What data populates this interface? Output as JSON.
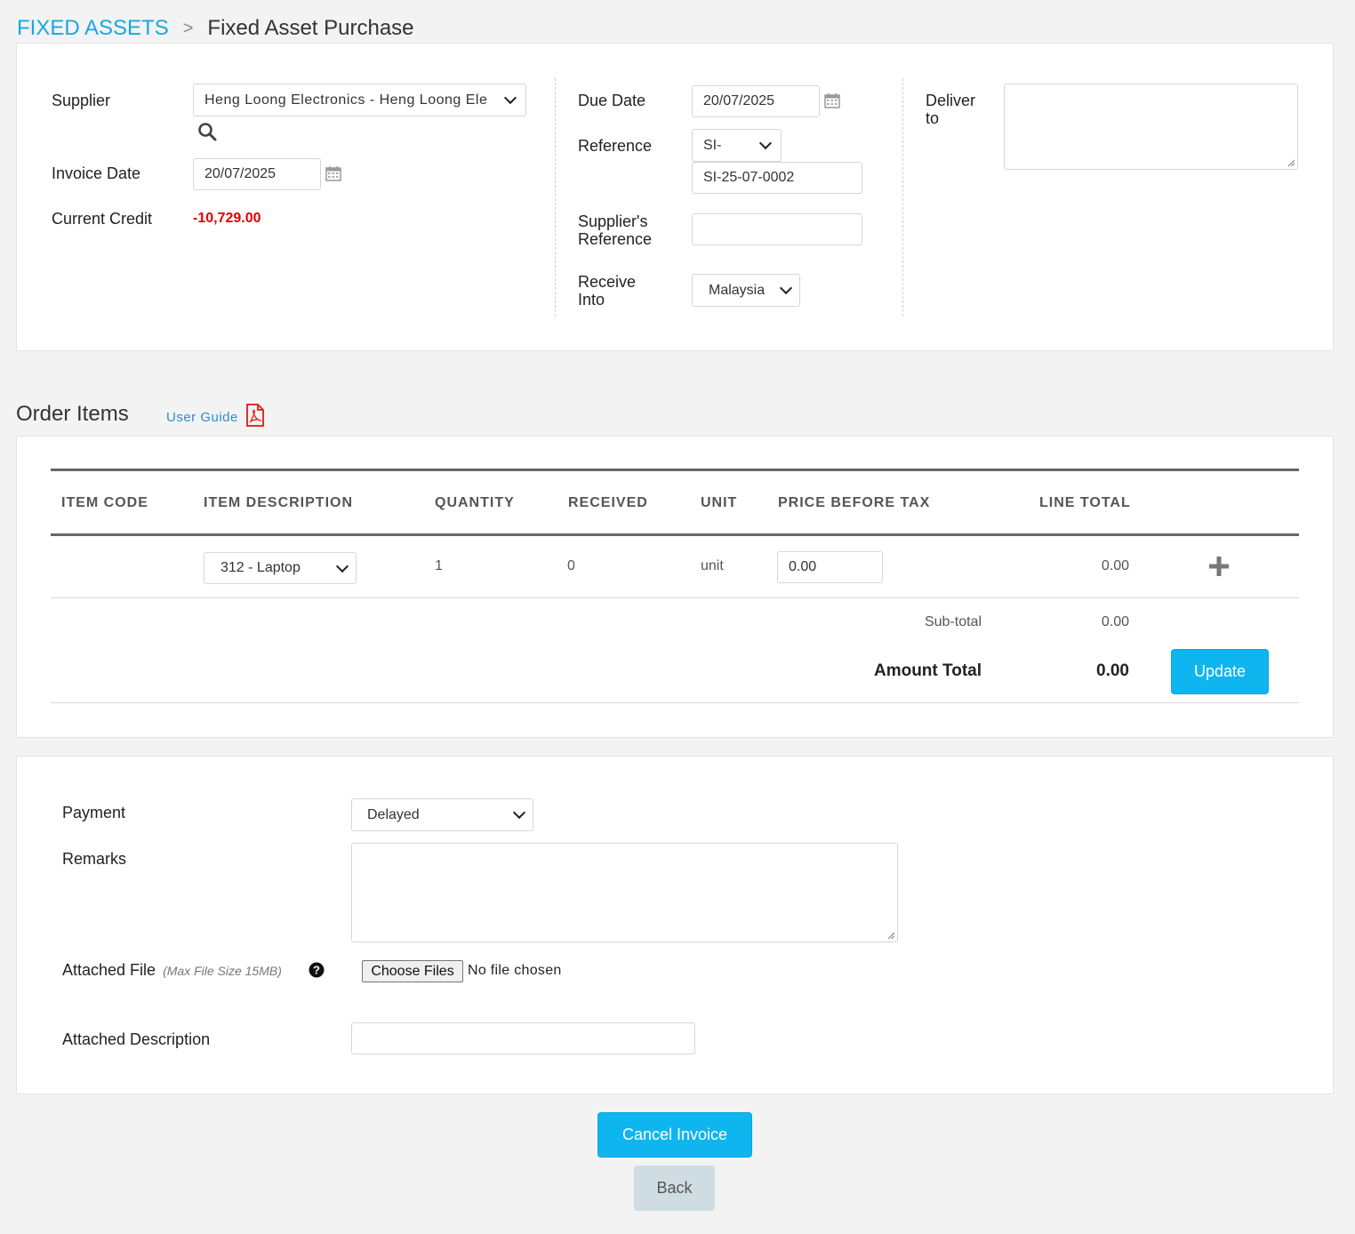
{
  "breadcrumb": {
    "parent": "FIXED ASSETS",
    "separator": ">",
    "current": "Fixed Asset Purchase"
  },
  "header": {
    "supplier_label": "Supplier",
    "supplier_value": "Heng Loong Electronics - Heng Loong Ele",
    "invoice_date_label": "Invoice Date",
    "invoice_date_value": "20/07/2025",
    "current_credit_label": "Current Credit",
    "current_credit_value": "-10,729.00",
    "due_date_label": "Due Date",
    "due_date_value": "20/07/2025",
    "reference_label": "Reference",
    "reference_prefix": "SI-",
    "reference_value": "SI-25-07-0002",
    "suppliers_reference_label_1": "Supplier's",
    "suppliers_reference_label_2": "Reference",
    "suppliers_reference_value": "",
    "receive_into_label_1": "Receive",
    "receive_into_label_2": "Into",
    "receive_into_value": "Malaysia",
    "deliver_to_label_1": "Deliver",
    "deliver_to_label_2": "to",
    "deliver_to_value": ""
  },
  "order_items": {
    "title": "Order Items",
    "user_guide": "User Guide",
    "columns": [
      "ITEM CODE",
      "ITEM DESCRIPTION",
      "QUANTITY",
      "RECEIVED",
      "UNIT",
      "PRICE BEFORE TAX",
      "LINE TOTAL"
    ],
    "rows": [
      {
        "item_code": "",
        "description": "312 - Laptop",
        "quantity": "1",
        "received": "0",
        "unit": "unit",
        "price": "0.00",
        "line_total": "0.00"
      }
    ],
    "subtotal_label": "Sub-total",
    "subtotal_value": "0.00",
    "amount_total_label": "Amount Total",
    "amount_total_value": "0.00",
    "update_button": "Update"
  },
  "footer_form": {
    "payment_label": "Payment",
    "payment_value": "Delayed",
    "remarks_label": "Remarks",
    "remarks_value": "",
    "attached_file_label": "Attached File",
    "attached_file_hint": "(Max File Size 15MB)",
    "choose_files": "Choose Files",
    "no_file": "No file chosen",
    "attached_description_label": "Attached Description",
    "attached_description_value": ""
  },
  "actions": {
    "cancel_invoice": "Cancel Invoice",
    "back": "Back"
  },
  "colors": {
    "accent": "#0fb5ee",
    "link": "#1aa7e0",
    "credit_negative": "#e00000",
    "pdf_icon": "#e0302a"
  }
}
